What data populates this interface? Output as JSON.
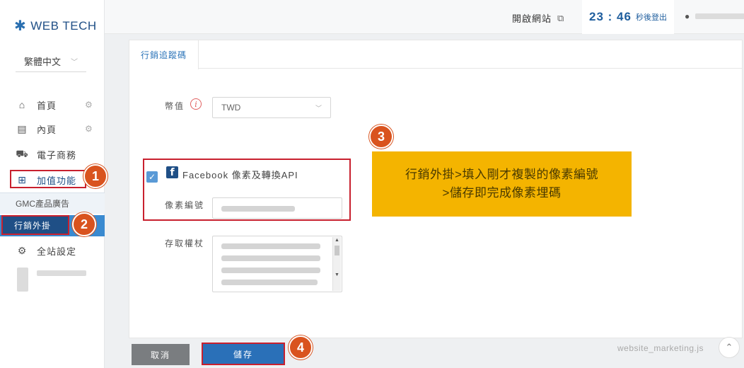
{
  "brand": {
    "name": "WEB TECH"
  },
  "language": {
    "selected": "繁體中文"
  },
  "sidebar": {
    "items": [
      {
        "label": "首頁"
      },
      {
        "label": "內頁"
      },
      {
        "label": "電子商務"
      },
      {
        "label": "加值功能"
      },
      {
        "label": "GMC產品廣告"
      },
      {
        "label": "行銷外掛"
      },
      {
        "label": "全站設定"
      }
    ]
  },
  "topbar": {
    "open_site": "開啟網站",
    "timer": "23 : 46",
    "timer_label": "秒後登出"
  },
  "tabs": [
    {
      "label": "行銷追蹤碼"
    }
  ],
  "form": {
    "currency_label": "幣值",
    "currency_value": "TWD",
    "facebook_label": "Facebook 像素及轉換API",
    "pixel_label": "像素編號",
    "token_label": "存取權杖"
  },
  "footer": {
    "cancel": "取消",
    "save": "儲存",
    "watermark": "website_marketing.js"
  },
  "annotations": {
    "badges": [
      "1",
      "2",
      "3",
      "4"
    ],
    "tip_line1": "行銷外掛>填入剛才複製的像素編號",
    "tip_line2": ">儲存即完成像素埋碼"
  }
}
